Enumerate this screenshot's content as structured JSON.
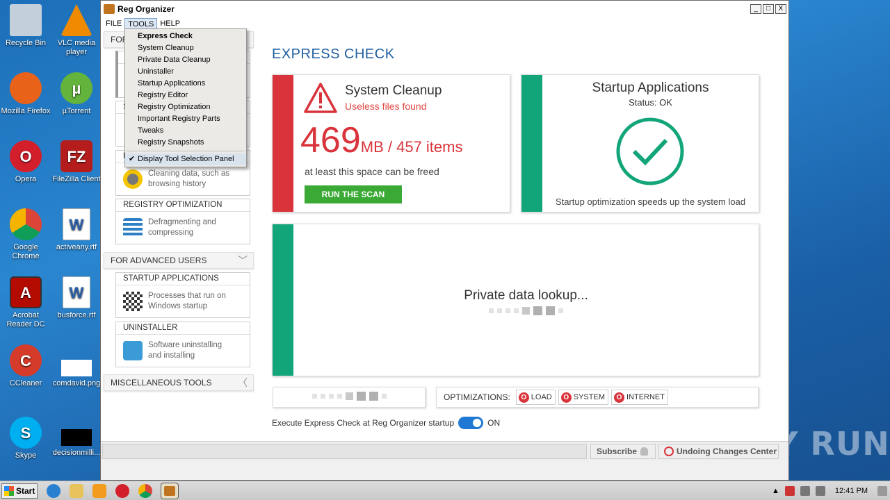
{
  "desktop": {
    "icons": [
      {
        "label": "Recycle Bin",
        "color": "#b8c7d6"
      },
      {
        "label": "VLC media player",
        "color": "#f08a00"
      },
      {
        "label": "Mozilla Firefox",
        "color": "#e8621a"
      },
      {
        "label": "µTorrent",
        "color": "#63b33c"
      },
      {
        "label": "Opera",
        "color": "#d31f2b"
      },
      {
        "label": "FileZilla Client",
        "color": "#b51d1d"
      },
      {
        "label": "Google Chrome",
        "color": "#4285f4"
      },
      {
        "label": "activeany.rtf",
        "color": "#2a5ea8"
      },
      {
        "label": "Acrobat Reader DC",
        "color": "#b30b00"
      },
      {
        "label": "busforce.rtf",
        "color": "#2a5ea8"
      },
      {
        "label": "CCleaner",
        "color": "#d53b2a"
      },
      {
        "label": "comdavid.png",
        "color": "#ffffff"
      },
      {
        "label": "Skype",
        "color": "#00aff0"
      },
      {
        "label": "decisionmilli...",
        "color": "#000000"
      }
    ],
    "watermark": "ANY RUN"
  },
  "window": {
    "title": "Reg Organizer",
    "menu": [
      "FILE",
      "TOOLS",
      "HELP"
    ],
    "controls": [
      "_",
      "□",
      "X"
    ]
  },
  "dropdown": {
    "items": [
      "Express Check",
      "System Cleanup",
      "Private Data Cleanup",
      "Uninstaller",
      "Startup Applications",
      "Registry Editor",
      "Registry Optimization",
      "Important Registry Parts",
      "Tweaks",
      "Registry Snapshots"
    ],
    "checked_item": "Display Tool Selection Panel",
    "check_mark": "✔"
  },
  "left": {
    "section_for_partial": "FOR",
    "card_private": {
      "text1": "Cleaning data, such as",
      "text2": "browsing history"
    },
    "card_registry": {
      "title": "REGISTRY OPTIMIZATION",
      "text1": "Defragmenting and",
      "text2": "compressing"
    },
    "section_advanced": "FOR ADVANCED USERS",
    "card_startup": {
      "title": "STARTUP APPLICATIONS",
      "text1": "Processes that run on",
      "text2": "Windows startup"
    },
    "card_uninstaller": {
      "title": "UNINSTALLER",
      "text1": "Software uninstalling",
      "text2": "and installing"
    },
    "section_misc": "MISCELLANEOUS TOOLS",
    "partial_labels": [
      "E",
      "S",
      "P"
    ]
  },
  "main": {
    "heading": "EXPRESS CHECK",
    "cleanup": {
      "title": "System Cleanup",
      "subtitle": "Useless files found",
      "size": "469",
      "size_unit": "MB / 457 items",
      "note": "at least this space can be freed",
      "button": "RUN THE SCAN"
    },
    "startup": {
      "title": "Startup Applications",
      "status": "Status: OK",
      "note": "Startup optimization speeds up the system load"
    },
    "private": {
      "title": "Private data lookup..."
    },
    "optimizations": {
      "label": "OPTIMIZATIONS:",
      "buttons": [
        "LOAD",
        "SYSTEM",
        "INTERNET"
      ]
    },
    "startup_toggle": {
      "label": "Execute Express Check at Reg Organizer startup",
      "state": "ON"
    }
  },
  "statusbar": {
    "subscribe": "Subscribe",
    "undo": "Undoing Changes Center"
  },
  "taskbar": {
    "start": "Start",
    "time": "12:41 PM"
  }
}
